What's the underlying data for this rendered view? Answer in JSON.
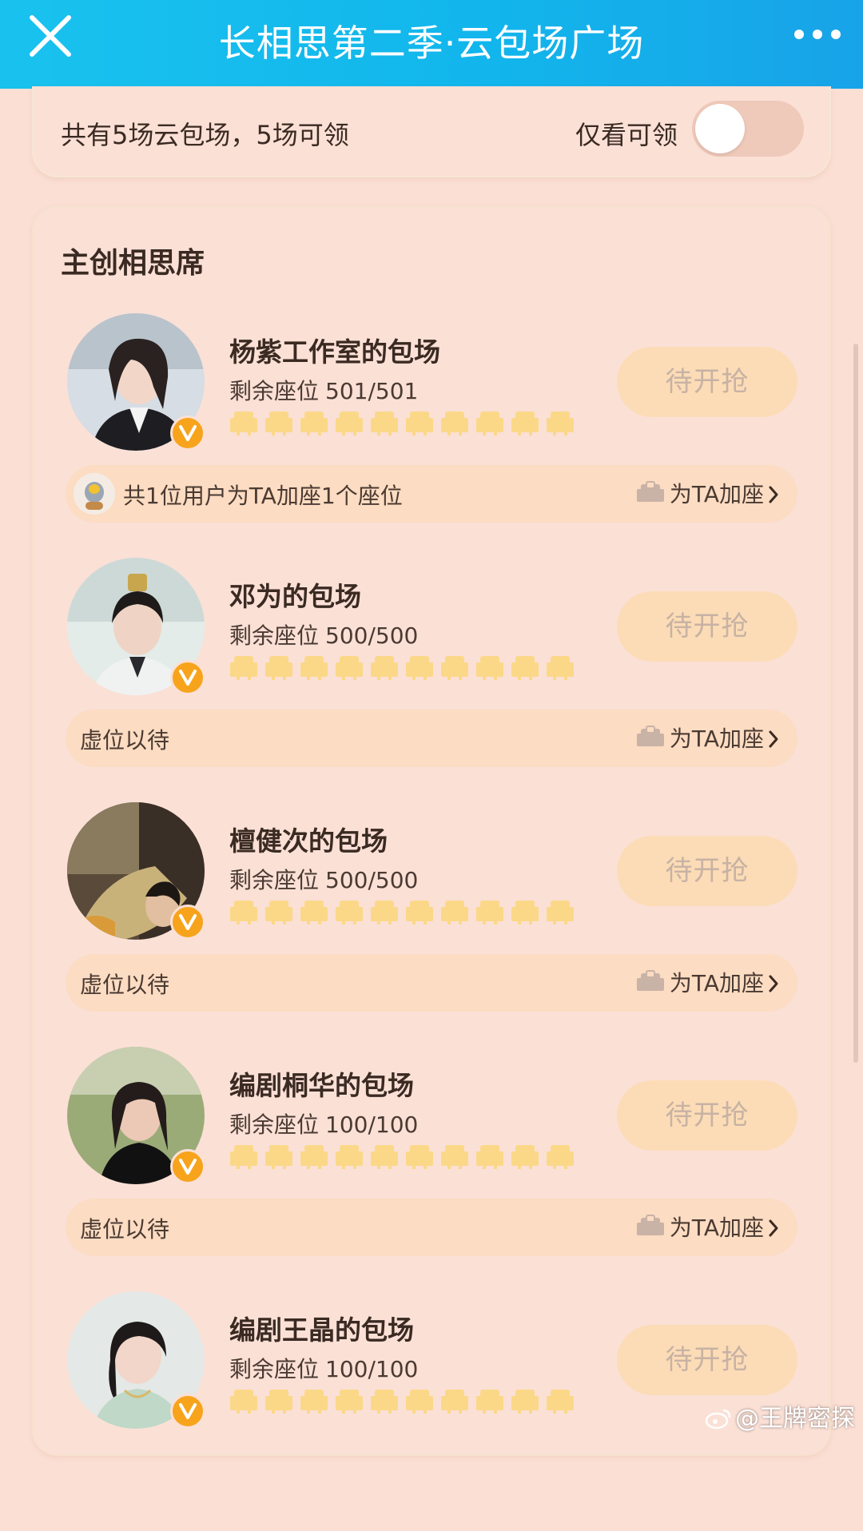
{
  "header": {
    "title": "长相思第二季·云包场广场",
    "close_icon": "close-icon",
    "more_icon": "more-dots-icon"
  },
  "summary": {
    "text": "共有5场云包场，5场可领",
    "filter_label": "仅看可领",
    "filter_enabled": false
  },
  "section": {
    "title": "主创相思席",
    "entries": [
      {
        "title": "杨紫工作室的包场",
        "seat_label": "剩余座位",
        "seat_count": "501/501",
        "button": "待开抢",
        "bar_text": "共1位用户为TA加座1个座位",
        "bar_has_avatar": true,
        "add_seat": "为TA加座"
      },
      {
        "title": "邓为的包场",
        "seat_label": "剩余座位",
        "seat_count": "500/500",
        "button": "待开抢",
        "bar_text": "虚位以待",
        "bar_has_avatar": false,
        "add_seat": "为TA加座"
      },
      {
        "title": "檀健次的包场",
        "seat_label": "剩余座位",
        "seat_count": "500/500",
        "button": "待开抢",
        "bar_text": "虚位以待",
        "bar_has_avatar": false,
        "add_seat": "为TA加座"
      },
      {
        "title": "编剧桐华的包场",
        "seat_label": "剩余座位",
        "seat_count": "100/100",
        "button": "待开抢",
        "bar_text": "虚位以待",
        "bar_has_avatar": false,
        "add_seat": "为TA加座"
      },
      {
        "title": "编剧王晶的包场",
        "seat_label": "剩余座位",
        "seat_count": "100/100",
        "button": "待开抢"
      }
    ]
  },
  "watermark": "@王牌密探",
  "colors": {
    "header_bg": "#14b8ec",
    "page_bg": "#fbdfd4",
    "button_bg": "#fcdcb6",
    "button_text": "#c7b2a4",
    "seat_icon": "#fbd888",
    "badge": "#f7a41c"
  }
}
